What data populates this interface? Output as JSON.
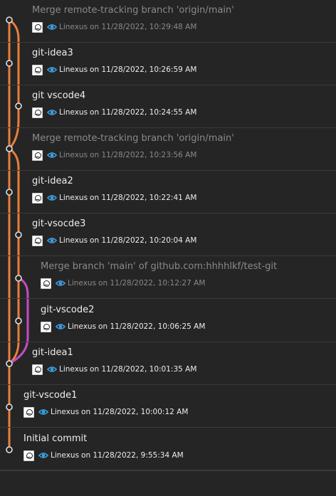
{
  "colors": {
    "background": "#252526",
    "lane_main": "#e87e3c",
    "lane_branch": "#c64cc4",
    "eye": "#3b9fe0"
  },
  "commits": [
    {
      "message": "Merge remote-tracking branch 'origin/main'",
      "author": "Linexus",
      "date": "on 11/28/2022, 10:29:48 AM",
      "merge": true
    },
    {
      "message": "git-idea3",
      "author": "Linexus",
      "date": "on 11/28/2022, 10:26:59 AM",
      "merge": false
    },
    {
      "message": "git vscode4",
      "author": "Linexus",
      "date": "on 11/28/2022, 10:24:55 AM",
      "merge": false
    },
    {
      "message": "Merge remote-tracking branch 'origin/main'",
      "author": "Linexus",
      "date": "on 11/28/2022, 10:23:56 AM",
      "merge": true
    },
    {
      "message": "git-idea2",
      "author": "Linexus",
      "date": "on 11/28/2022, 10:22:41 AM",
      "merge": false
    },
    {
      "message": "git-vsocde3",
      "author": "Linexus",
      "date": "on 11/28/2022, 10:20:04 AM",
      "merge": false
    },
    {
      "message": "Merge branch 'main' of github.com:hhhhlkf/test-git",
      "author": "Linexus",
      "date": "on 11/28/2022, 10:12:27 AM",
      "merge": true
    },
    {
      "message": "git-vscode2",
      "author": "Linexus",
      "date": "on 11/28/2022, 10:06:25 AM",
      "merge": false
    },
    {
      "message": "git-idea1",
      "author": "Linexus",
      "date": "on 11/28/2022, 10:01:35 AM",
      "merge": false
    },
    {
      "message": "git-vscode1",
      "author": "Linexus",
      "date": "on 11/28/2022, 10:00:12 AM",
      "merge": false
    },
    {
      "message": "Initial commit",
      "author": "Linexus",
      "date": "on 11/28/2022, 9:55:34 AM",
      "merge": false
    }
  ]
}
